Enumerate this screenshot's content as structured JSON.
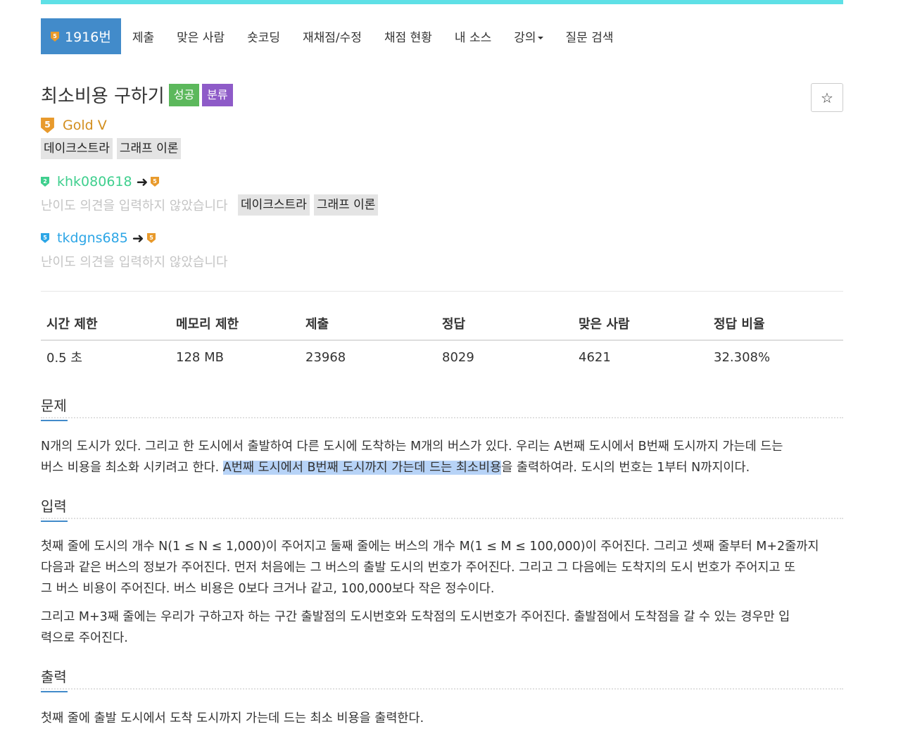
{
  "colors": {
    "accent": "#428bca",
    "top_bar": "#5ee0e6",
    "success": "#5cb85c",
    "category": "#8e5bc8",
    "gold": "#d28e1e",
    "silver_user": "#27d28a",
    "gold_user": "#2da6e6",
    "placeholder_text": "#c4c4c4",
    "selection_highlight": "#b7d3f7"
  },
  "nav": {
    "problem_number": "1916번",
    "items": [
      "제출",
      "맞은 사람",
      "숏코딩",
      "재채점/수정",
      "채점 현황",
      "내 소스",
      "강의",
      "질문 검색"
    ]
  },
  "problem": {
    "title": "최소비용 구하기",
    "label_success": "성공",
    "label_category": "분류",
    "star_icon": "☆",
    "tier_badge": "5",
    "tier": "Gold V",
    "tags": [
      "데이크스트라",
      "그래프 이론"
    ]
  },
  "contributors": [
    {
      "badge_from": "2",
      "username": "khk080618",
      "arrow": "➜",
      "badge_to": "5",
      "opinion": "난이도 의견을 입력하지 않았습니다",
      "tags": [
        "데이크스트라",
        "그래프 이론"
      ]
    },
    {
      "badge_from": "5",
      "username": "tkdgns685",
      "arrow": "➜",
      "badge_to": "5",
      "opinion": "난이도 의견을 입력하지 않았습니다"
    }
  ],
  "stats": {
    "headers": [
      "시간 제한",
      "메모리 제한",
      "제출",
      "정답",
      "맞은 사람",
      "정답 비율"
    ],
    "values": [
      "0.5 초",
      "128 MB",
      "23968",
      "8029",
      "4621",
      "32.308%"
    ]
  },
  "sections": {
    "problem_title": "문제",
    "problem_line1": "N개의 도시가 있다. 그리고 한 도시에서 출발하여 다른 도시에 도착하는 M개의 버스가 있다. 우리는 A번째 도시에서 B번째 도시까지 가는데 드는",
    "problem_line2_a": "버스 비용을 최소화 시키려고 한다. ",
    "problem_line2_hl": "A번째 도시에서 B번째 도시까지 가는데 드는 최소비용",
    "problem_line2_b": "을 출력하여라. 도시의 번호는 1부터 N까지이다.",
    "input_title": "입력",
    "input_p1_l1": "첫째 줄에 도시의 개수 N(1 ≤ N ≤ 1,000)이 주어지고 둘째 줄에는 버스의 개수 M(1 ≤ M ≤ 100,000)이 주어진다. 그리고 셋째 줄부터 M+2줄까지",
    "input_p1_l2": "다음과 같은 버스의 정보가 주어진다. 먼저 처음에는 그 버스의 출발 도시의 번호가 주어진다. 그리고 그 다음에는 도착지의 도시 번호가 주어지고 또",
    "input_p1_l3": "그 버스 비용이 주어진다. 버스 비용은 0보다 크거나 같고, 100,000보다 작은 정수이다.",
    "input_p2_l1": "그리고 M+3째 줄에는 우리가 구하고자 하는 구간 출발점의 도시번호와 도착점의 도시번호가 주어진다. 출발점에서 도착점을 갈 수 있는 경우만 입",
    "input_p2_l2": "력으로 주어진다.",
    "output_title": "출력",
    "output_text": "첫째 줄에 출발 도시에서 도착 도시까지 가는데 드는 최소 비용을 출력한다."
  }
}
